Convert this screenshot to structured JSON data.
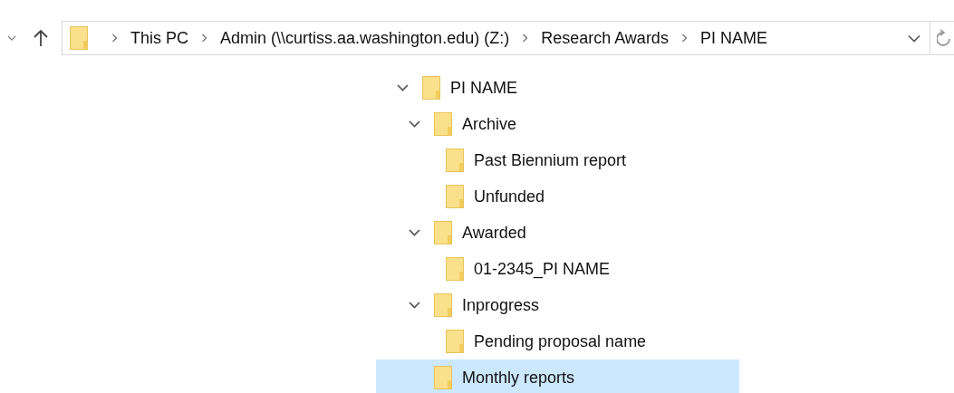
{
  "address_bar": {
    "breadcrumbs": [
      "This PC",
      "Admin (\\\\curtiss.aa.washington.edu) (Z:)",
      "Research Awards",
      "PI NAME"
    ]
  },
  "tree": [
    {
      "label": "PI NAME",
      "expanded": true,
      "selected": false,
      "children": [
        {
          "label": "Archive",
          "expanded": true,
          "selected": false,
          "children": [
            {
              "label": "Past Biennium report",
              "selected": false
            },
            {
              "label": "Unfunded",
              "selected": false
            }
          ]
        },
        {
          "label": "Awarded",
          "expanded": true,
          "selected": false,
          "children": [
            {
              "label": "01-2345_PI NAME",
              "selected": false
            }
          ]
        },
        {
          "label": "Inprogress",
          "expanded": true,
          "selected": false,
          "children": [
            {
              "label": "Pending proposal name",
              "selected": false
            }
          ]
        },
        {
          "label": "Monthly reports",
          "selected": true
        }
      ]
    }
  ]
}
